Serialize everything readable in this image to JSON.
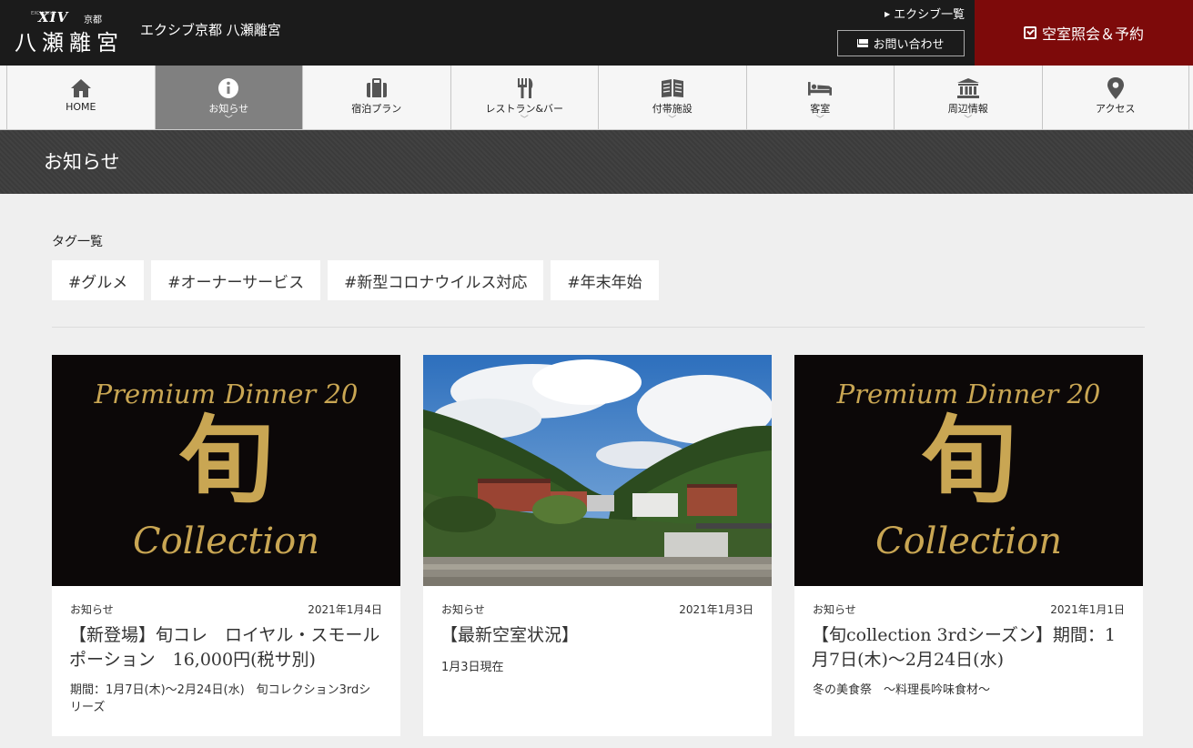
{
  "header": {
    "logo": {
      "brand": "XIV",
      "city": "京都",
      "name": "八瀬離宮",
      "tiny": "EXCLUSIVE"
    },
    "site_name": "エクシブ京都 八瀬離宮",
    "xiv_list_link": "エクシブ一覧",
    "contact_label": "お問い合わせ",
    "reserve_label": "空室照会＆予約",
    "reserve_color": "#7d0a0a"
  },
  "nav": {
    "items": [
      {
        "label": "HOME",
        "icon": "home-icon"
      },
      {
        "label": "お知らせ",
        "icon": "info-icon",
        "active": true
      },
      {
        "label": "宿泊プラン",
        "icon": "suitcase-icon"
      },
      {
        "label": "レストラン&バー",
        "icon": "restaurant-icon"
      },
      {
        "label": "付帯施設",
        "icon": "book-icon"
      },
      {
        "label": "客室",
        "icon": "bed-icon"
      },
      {
        "label": "周辺情報",
        "icon": "museum-icon"
      },
      {
        "label": "アクセス",
        "icon": "map-pin-icon"
      }
    ]
  },
  "page": {
    "title": "お知らせ"
  },
  "tags": {
    "heading": "タグ一覧",
    "items": [
      "#グルメ",
      "#オーナーサービス",
      "#新型コロナウイルス対応",
      "#年末年始"
    ]
  },
  "cards": [
    {
      "category": "お知らせ",
      "date": "2021年1月4日",
      "title": "【新登場】旬コレ　ロイヤル・スモールポーション　16,000円(税サ別)",
      "desc": "期間：1月7日(木)～2月24日(水)　旬コレクション3rdシリーズ",
      "image": {
        "line1": "Premium Dinner 20",
        "kanji": "旬",
        "line2": "Collection"
      }
    },
    {
      "category": "お知らせ",
      "date": "2021年1月3日",
      "title": "【最新空室状況】",
      "desc": "1月3日現在"
    },
    {
      "category": "お知らせ",
      "date": "2021年1月1日",
      "title": "【旬collection 3rdシーズン】期間：1月7日(木)～2月24日(水)",
      "desc": "冬の美食祭　～料理長吟味食材～",
      "image": {
        "line1": "Premium Dinner 20",
        "kanji": "旬",
        "line2": "Collection"
      }
    }
  ]
}
